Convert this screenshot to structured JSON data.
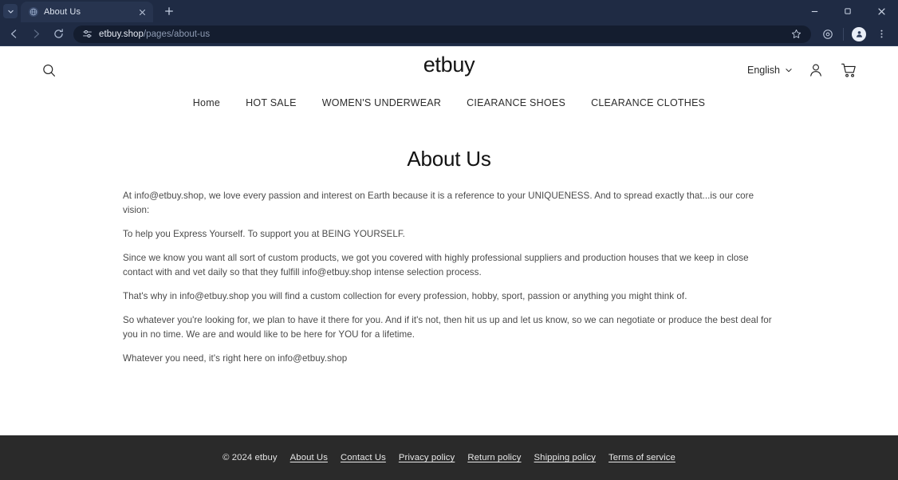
{
  "browser": {
    "tab": {
      "title": "About Us",
      "favicon": "globe-icon",
      "close_label": "×"
    },
    "new_tab_label": "+",
    "tab_search_label": "▾",
    "window": {
      "minimize_label": "−",
      "maximize_label": "□",
      "close_label": "×"
    },
    "toolbar": {
      "back_label": "←",
      "forward_label": "→",
      "reload_label": "↻",
      "site_info_icon": "tune-icon",
      "url_host": "etbuy.shop",
      "url_path": "/pages/about-us",
      "bookmark_icon": "star-icon",
      "extensions_icon": "puzzle-icon",
      "profile_icon": "person-icon",
      "menu_icon": "kebab-menu-icon"
    }
  },
  "site": {
    "brand": "etbuy",
    "search_icon": "search-icon",
    "language": {
      "label": "English",
      "caret": "⌄"
    },
    "account_icon": "person-icon",
    "cart_icon": "cart-icon",
    "nav": [
      {
        "label": "Home"
      },
      {
        "label": "HOT SALE"
      },
      {
        "label": "WOMEN'S UNDERWEAR"
      },
      {
        "label": "CIEARANCE SHOES"
      },
      {
        "label": "CLEARANCE CLOTHES"
      }
    ],
    "page": {
      "title": "About Us",
      "paragraphs": [
        "At info@etbuy.shop, we love every passion and interest on Earth because it is a reference to your UNIQUENESS. And to spread exactly that...is our core vision:",
        "To help you Express Yourself. To support you at BEING YOURSELF.",
        "Since we know you want all sort of custom products, we got you covered with highly professional suppliers and production houses that we keep in close contact with and vet daily so that they fulfill info@etbuy.shop intense selection process.",
        "That's why in info@etbuy.shop   you will find a custom collection for every profession, hobby, sport, passion or anything you might think of.",
        "So whatever you're looking for, we plan to have it there for you. And if it's not, then hit us up and let us know, so we can negotiate or produce the best deal for you in no time. We are and would like to be here for YOU for a lifetime.",
        "Whatever you need, it's right here on info@etbuy.shop"
      ]
    },
    "footer": {
      "copyright": "© 2024 etbuy",
      "links": [
        {
          "label": "About Us"
        },
        {
          "label": "Contact Us"
        },
        {
          "label": "Privacy policy"
        },
        {
          "label": "Return policy"
        },
        {
          "label": "Shipping policy"
        },
        {
          "label": "Terms of service"
        }
      ]
    }
  },
  "colors": {
    "chrome_bg": "#1f2b44",
    "tab_active": "#27344f",
    "omnibox_bg": "#141d2f",
    "footer_bg": "#2a2a2a",
    "page_text": "#4a4a4a"
  }
}
